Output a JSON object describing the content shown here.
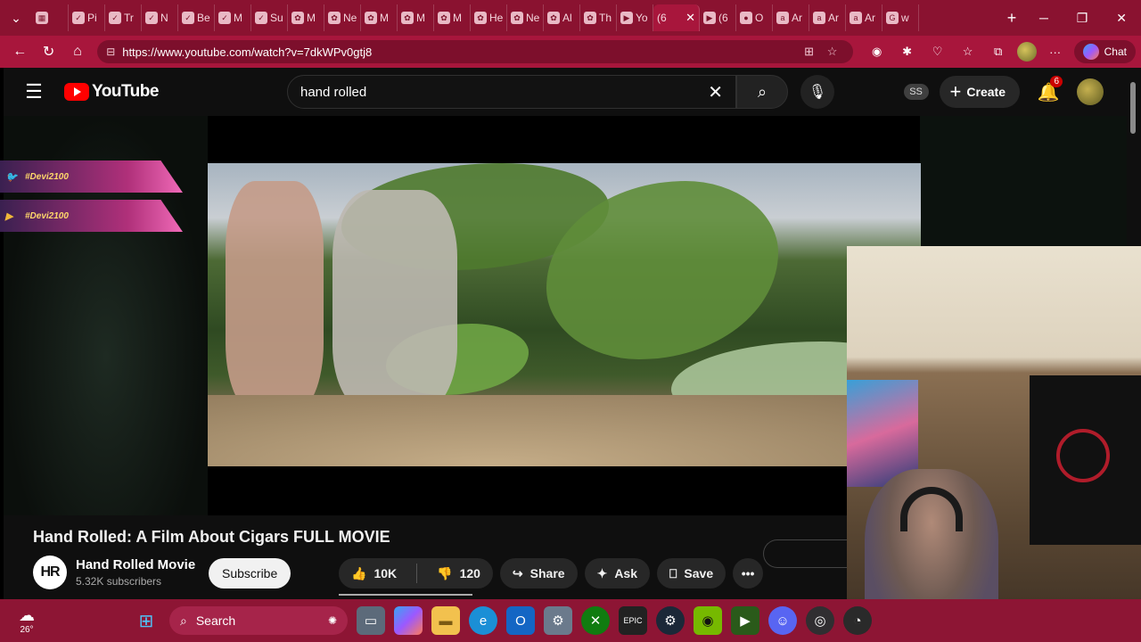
{
  "browser": {
    "tabs": [
      {
        "label": "",
        "icon": "grid-app-icon"
      },
      {
        "label": "Pi",
        "icon": "pin-icon"
      },
      {
        "label": "Tr",
        "icon": "check-icon"
      },
      {
        "label": "N",
        "icon": "check-icon"
      },
      {
        "label": "Be",
        "icon": "check-icon"
      },
      {
        "label": "M",
        "icon": "check-icon"
      },
      {
        "label": "Su",
        "icon": "check-icon"
      },
      {
        "label": "M",
        "icon": "openai-icon"
      },
      {
        "label": "Ne",
        "icon": "openai-icon"
      },
      {
        "label": "M",
        "icon": "openai-icon"
      },
      {
        "label": "M",
        "icon": "openai-icon"
      },
      {
        "label": "M",
        "icon": "openai-icon"
      },
      {
        "label": "He",
        "icon": "openai-icon"
      },
      {
        "label": "Ne",
        "icon": "openai-icon"
      },
      {
        "label": "Al",
        "icon": "openai-icon"
      },
      {
        "label": "Th",
        "icon": "openai-icon"
      },
      {
        "label": "Yo",
        "icon": "youtube-icon"
      },
      {
        "label": "(6",
        "icon": "youtube-icon",
        "active": true
      },
      {
        "label": "(6",
        "icon": "youtube-icon"
      },
      {
        "label": "O",
        "icon": "page-icon"
      },
      {
        "label": "Ar",
        "icon": "amazon-icon"
      },
      {
        "label": "Ar",
        "icon": "amazon-icon"
      },
      {
        "label": "Ar",
        "icon": "amazon-icon"
      },
      {
        "label": "w",
        "icon": "google-icon"
      }
    ],
    "url": "https://www.youtube.com/watch?v=7dkWPv0gtj8",
    "chat_label": "Chat"
  },
  "youtube": {
    "logo_text": "YouTube",
    "search_query": "hand rolled",
    "ss_badge": "SS",
    "create_label": "Create",
    "notification_count": "6",
    "video_title": "Hand Rolled: A Film About Cigars FULL MOVIE",
    "channel_name": "Hand Rolled Movie",
    "channel_initials": "HR",
    "subscribers": "5.32K subscribers",
    "subscribe_label": "Subscribe",
    "likes": "10K",
    "dislikes": "120",
    "share_label": "Share",
    "ask_label": "Ask",
    "save_label": "Save"
  },
  "overlay": {
    "banners": [
      {
        "handle": "#Devi2100",
        "icon": "twitter-icon"
      },
      {
        "handle": "#Devi2100",
        "icon": "youtube-icon"
      }
    ]
  },
  "taskbar": {
    "temperature": "26°",
    "search_label": "Search",
    "apps": [
      "file-explorer-icon",
      "copilot-icon",
      "folder-icon",
      "edge-icon",
      "outlook-icon",
      "settings-icon",
      "xbox-icon",
      "epic-games-icon",
      "steam-icon",
      "nvidia-icon",
      "game-app-icon",
      "discord-icon",
      "obs-icon",
      "speedometer-icon"
    ]
  },
  "colors": {
    "browser_frame": "#8a1230",
    "youtube_red": "#ff0000",
    "yt_background": "#0f0f0f"
  }
}
